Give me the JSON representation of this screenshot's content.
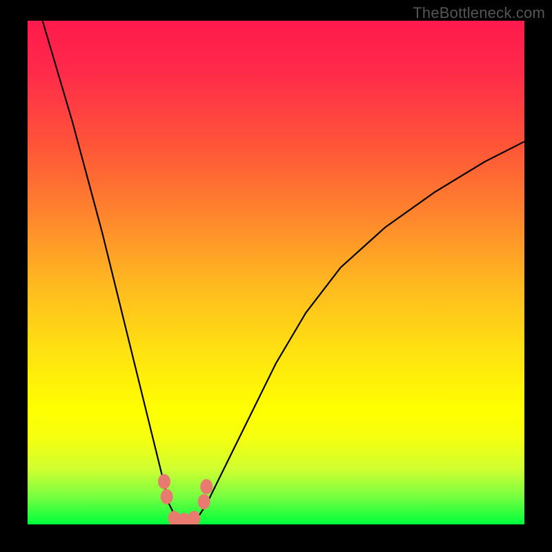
{
  "watermark": "TheBottleneck.com",
  "chart_data": {
    "type": "line",
    "title": "",
    "xlabel": "",
    "ylabel": "",
    "xlim": [
      0,
      1
    ],
    "ylim": [
      0,
      1
    ],
    "grid": false,
    "legend": false,
    "note": "Black V-shaped bottleneck curve over a red→yellow→green vertical gradient. Values estimated from pixel positions (no axis labels present).",
    "series": [
      {
        "name": "bottleneck-left",
        "x": [
          0.03,
          0.06,
          0.09,
          0.12,
          0.15,
          0.18,
          0.21,
          0.24,
          0.27,
          0.285,
          0.3
        ],
        "y": [
          1.0,
          0.9,
          0.8,
          0.69,
          0.58,
          0.46,
          0.34,
          0.22,
          0.1,
          0.04,
          0.01
        ]
      },
      {
        "name": "bottleneck-right",
        "x": [
          0.34,
          0.36,
          0.4,
          0.45,
          0.5,
          0.56,
          0.63,
          0.72,
          0.82,
          0.92,
          1.0
        ],
        "y": [
          0.01,
          0.04,
          0.12,
          0.22,
          0.32,
          0.42,
          0.51,
          0.59,
          0.66,
          0.72,
          0.76
        ]
      },
      {
        "name": "bottleneck-floor",
        "x": [
          0.3,
          0.32,
          0.34
        ],
        "y": [
          0.01,
          0.005,
          0.01
        ]
      }
    ],
    "markers": [
      {
        "name": "left-marker-upper",
        "x": 0.275,
        "y": 0.085
      },
      {
        "name": "left-marker-lower",
        "x": 0.28,
        "y": 0.055
      },
      {
        "name": "floor-marker-1",
        "x": 0.295,
        "y": 0.012
      },
      {
        "name": "floor-marker-2",
        "x": 0.315,
        "y": 0.008
      },
      {
        "name": "floor-marker-3",
        "x": 0.335,
        "y": 0.012
      },
      {
        "name": "right-marker-lower",
        "x": 0.355,
        "y": 0.045
      },
      {
        "name": "right-marker-upper",
        "x": 0.36,
        "y": 0.075
      }
    ],
    "background_gradient": {
      "direction": "top-to-bottom",
      "stops": [
        {
          "pos": 0.0,
          "color": "#ff1a4d"
        },
        {
          "pos": 0.25,
          "color": "#ff5538"
        },
        {
          "pos": 0.52,
          "color": "#ffb820"
        },
        {
          "pos": 0.77,
          "color": "#ffff00"
        },
        {
          "pos": 1.0,
          "color": "#00ff3c"
        }
      ]
    }
  }
}
